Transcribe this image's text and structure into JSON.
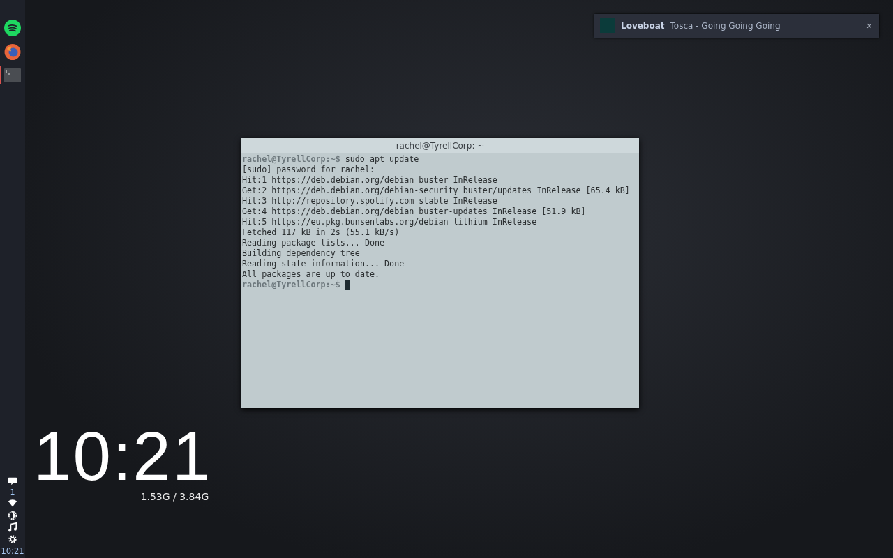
{
  "panel": {
    "apps": [
      {
        "kind": "spotify",
        "selected": false
      },
      {
        "kind": "firefox",
        "selected": false
      },
      {
        "kind": "terminal",
        "selected": true
      }
    ],
    "tray": {
      "notification_count": "1",
      "time": "10:21"
    }
  },
  "notification": {
    "title": "Loveboat",
    "body": "Tosca - Going Going Going",
    "close": "×"
  },
  "terminal": {
    "title": "rachel@TyrellCorp: ~",
    "cursor": true,
    "lines": [
      {
        "kind": "prompt",
        "prompt": "rachel@TyrellCorp",
        "path": ":~$",
        "command": "sudo apt update"
      },
      {
        "kind": "output",
        "text": "[sudo] password for rachel:"
      },
      {
        "kind": "output",
        "text": "Hit:1 https://deb.debian.org/debian buster InRelease"
      },
      {
        "kind": "output",
        "text": "Get:2 https://deb.debian.org/debian-security buster/updates InRelease [65.4 kB]"
      },
      {
        "kind": "output",
        "text": "Hit:3 http://repository.spotify.com stable InRelease"
      },
      {
        "kind": "output",
        "text": "Get:4 https://deb.debian.org/debian buster-updates InRelease [51.9 kB]"
      },
      {
        "kind": "output",
        "text": "Hit:5 https://eu.pkg.bunsenlabs.org/debian lithium InRelease"
      },
      {
        "kind": "output",
        "text": "Fetched 117 kB in 2s (55.1 kB/s)"
      },
      {
        "kind": "output",
        "text": "Reading package lists... Done"
      },
      {
        "kind": "output",
        "text": "Building dependency tree"
      },
      {
        "kind": "output",
        "text": "Reading state information... Done"
      },
      {
        "kind": "output",
        "text": "All packages are up to date."
      },
      {
        "kind": "prompt",
        "prompt": "rachel@TyrellCorp",
        "path": ":~$"
      }
    ]
  },
  "clock": {
    "time": "10:21",
    "memory": "1.53G / 3.84G"
  }
}
